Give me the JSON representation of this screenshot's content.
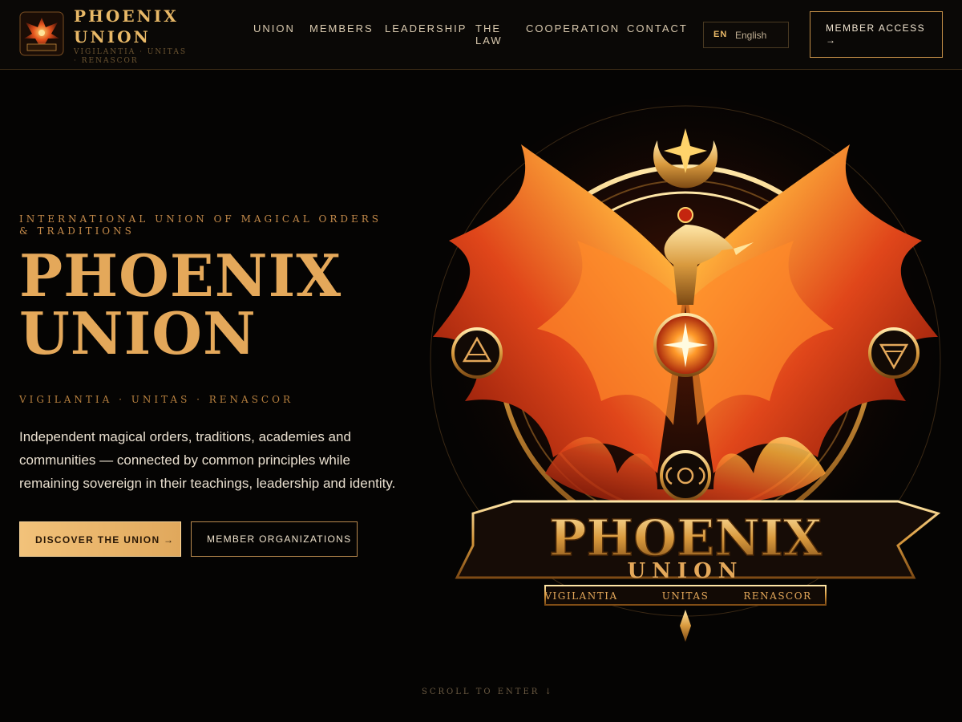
{
  "brand": {
    "name": "PHOENIX UNION",
    "tagline": "VIGILANTIA · UNITAS · RENASCOR",
    "logo_text": "PHOENIX"
  },
  "nav": {
    "items": [
      {
        "label": "UNION"
      },
      {
        "label": "MEMBERS"
      },
      {
        "label": "LEADERSHIP"
      },
      {
        "label": "THE LAW"
      },
      {
        "label": "COOPERATION"
      },
      {
        "label": "CONTACT"
      }
    ]
  },
  "language": {
    "code": "EN",
    "name": "English"
  },
  "member_access": {
    "label": "MEMBER ACCESS →"
  },
  "hero": {
    "eyebrow": "INTERNATIONAL UNION OF MAGICAL ORDERS & TRADITIONS",
    "title_line1": "PHOENIX",
    "title_line2": "UNION",
    "motto": "VIGILANTIA · UNITAS · RENASCOR",
    "lead": "Independent magical orders, traditions, academies and communities — connected by common principles while remaining sovereign in their teachings, leadership and identity.",
    "primary_cta": "DISCOVER THE UNION →",
    "secondary_cta": "MEMBER ORGANIZATIONS"
  },
  "emblem": {
    "word1": "PHOENIX",
    "word2": "UNION",
    "motto_1": "VIGILANTIA",
    "motto_2": "UNITAS",
    "motto_3": "RENASCOR"
  },
  "scroll_cue": "SCROLL TO ENTER ↓",
  "colors": {
    "gold": "#e4a85a",
    "flame": "#e0461a",
    "background": "#050403"
  }
}
